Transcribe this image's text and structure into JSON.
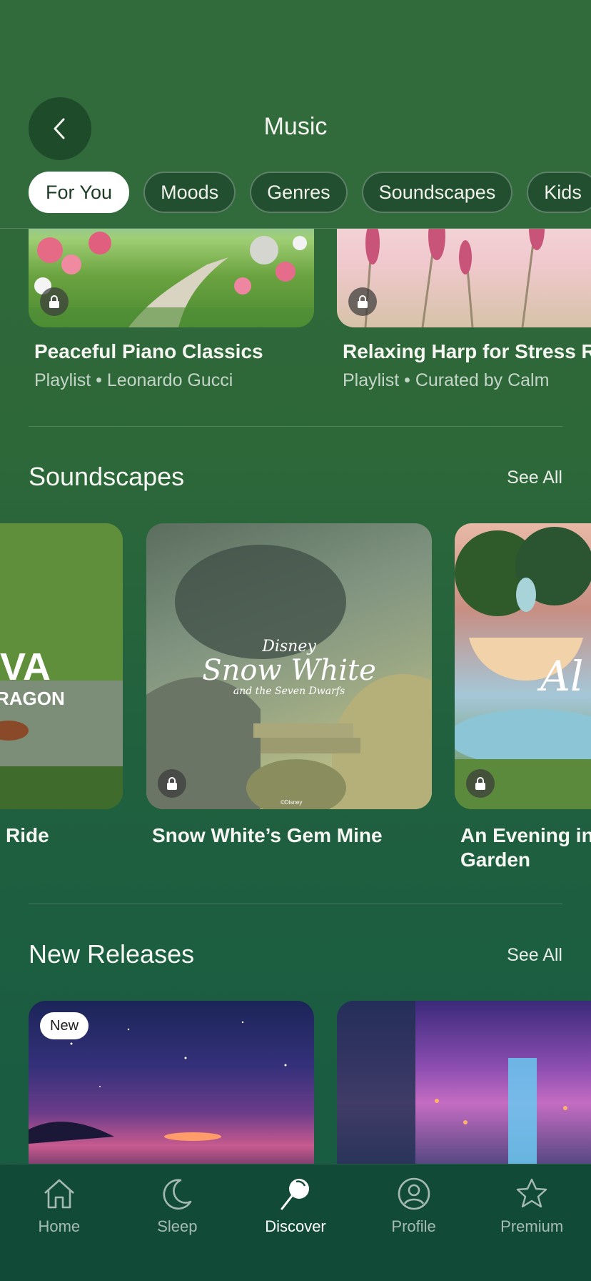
{
  "header": {
    "title": "Music",
    "tabs": [
      {
        "label": "For You",
        "active": true
      },
      {
        "label": "Moods"
      },
      {
        "label": "Genres"
      },
      {
        "label": "Soundscapes"
      },
      {
        "label": "Kids"
      }
    ]
  },
  "playlists": [
    {
      "title": "Peaceful Piano Classics",
      "subtitle": "Playlist • Leonardo Gucci",
      "locked": true
    },
    {
      "title": "Relaxing Harp for Stress Re",
      "subtitle": "Playlist • Curated by Calm",
      "locked": true
    }
  ],
  "soundscapes": {
    "title": "Soundscapes",
    "see_all": "See All",
    "items": [
      {
        "title": "Ride",
        "art_text": "VA",
        "art_text2": "RAGON"
      },
      {
        "title": "Snow White’s Gem Mine",
        "art_brand": "Disney",
        "art_title": "Snow White",
        "art_subtitle": "and the Seven Dwarfs",
        "art_copyright": "©Disney",
        "locked": true
      },
      {
        "title_line1": "An Evening in",
        "title_line2": "Garden",
        "art_text": "Al",
        "locked": true
      }
    ]
  },
  "new_releases": {
    "title": "New Releases",
    "see_all": "See All",
    "badge": "New"
  },
  "tabbar": {
    "items": [
      {
        "label": "Home",
        "icon": "home-icon"
      },
      {
        "label": "Sleep",
        "icon": "moon-icon"
      },
      {
        "label": "Discover",
        "icon": "discover-icon",
        "active": true
      },
      {
        "label": "Profile",
        "icon": "profile-icon"
      },
      {
        "label": "Premium",
        "icon": "star-icon"
      }
    ]
  }
}
